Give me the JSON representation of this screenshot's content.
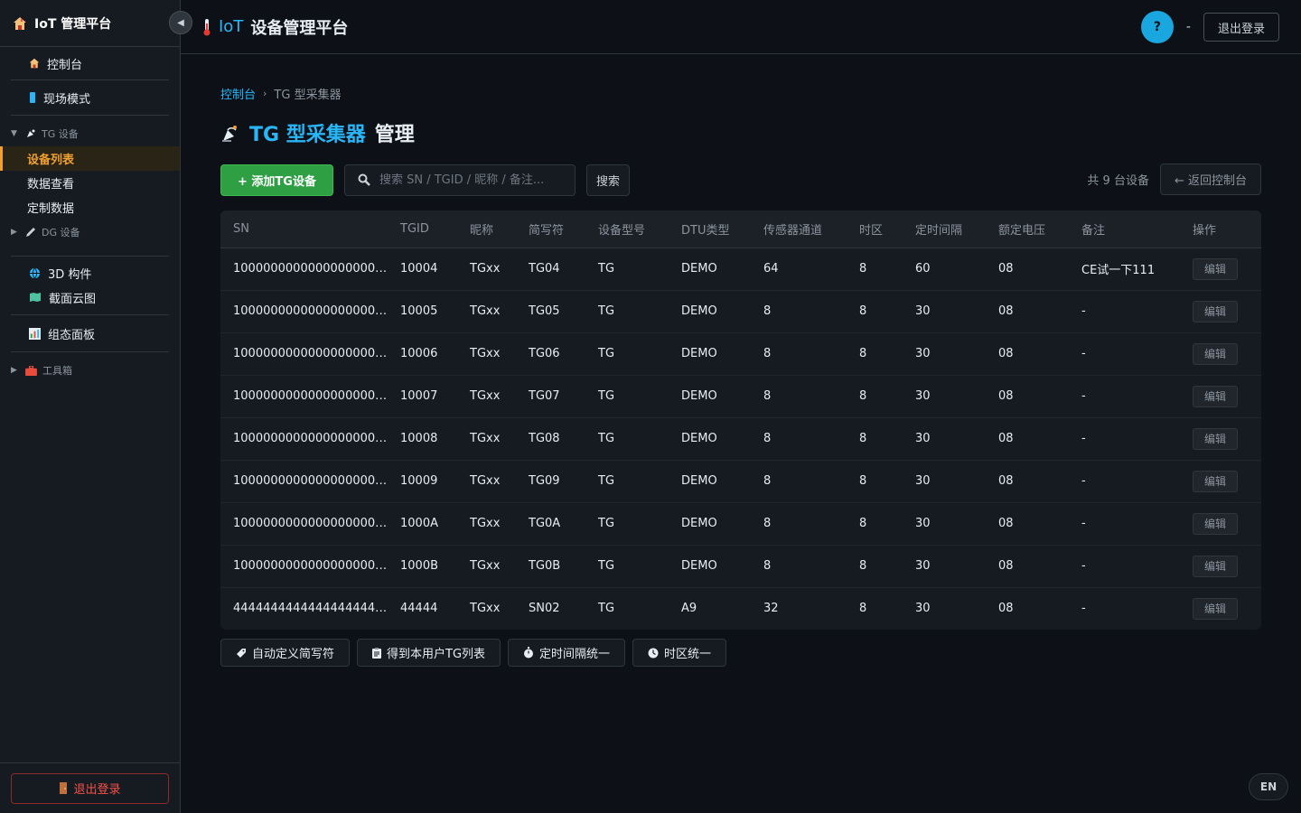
{
  "sidebar": {
    "brand": "IoT 管理平台",
    "collapse_glyph": "◀",
    "top_items": [
      {
        "label": "控制台",
        "icon": "home-icon"
      },
      {
        "label": "现场模式",
        "icon": "device-icon"
      }
    ],
    "tg_group": {
      "label": "TG 设备",
      "caret": "▼",
      "icon": "satellite-icon"
    },
    "tg_items": [
      {
        "label": "设备列表",
        "active": true
      },
      {
        "label": "数据查看"
      },
      {
        "label": "定制数据"
      }
    ],
    "dg_group": {
      "label": "DG 设备",
      "caret": "▶",
      "icon": "pen-icon"
    },
    "mid_items": [
      {
        "label": "3D 构件",
        "icon": "globe-icon"
      },
      {
        "label": "截面云图",
        "icon": "map-icon"
      }
    ],
    "panel_item": {
      "label": "组态面板",
      "icon": "chart-icon"
    },
    "tools_group": {
      "label": "工具箱",
      "caret": "▶",
      "icon": "toolbox-icon"
    },
    "logout_label": "退出登录"
  },
  "header": {
    "iot": "IoT",
    "title_rest": "设备管理平台",
    "avatar": "?",
    "user_dash": "-",
    "logout_label": "退出登录"
  },
  "breadcrumb": {
    "home": "控制台",
    "sep": "›",
    "current": "TG 型采集器"
  },
  "page_title": {
    "tg": "TG 型采集器",
    "manage": "管理"
  },
  "toolbar": {
    "add_label": "+ 添加TG设备",
    "search_placeholder": "搜索 SN / TGID / 昵称 / 备注...",
    "search_button": "搜索",
    "count_text": "共 9 台设备",
    "back_label": "← 返回控制台"
  },
  "table": {
    "headers": [
      "SN",
      "TGID",
      "昵称",
      "简写符",
      "设备型号",
      "DTU类型",
      "传感器通道",
      "时区",
      "定时间隔",
      "额定电压",
      "备注",
      "操作"
    ],
    "edit_label": "编辑",
    "rows": [
      [
        "10000000000000000000...",
        "10004",
        "TGxx",
        "TG04",
        "TG",
        "DEMO",
        "64",
        "8",
        "60",
        "08",
        "CE试一下111"
      ],
      [
        "10000000000000000000...",
        "10005",
        "TGxx",
        "TG05",
        "TG",
        "DEMO",
        "8",
        "8",
        "30",
        "08",
        "-"
      ],
      [
        "10000000000000000000...",
        "10006",
        "TGxx",
        "TG06",
        "TG",
        "DEMO",
        "8",
        "8",
        "30",
        "08",
        "-"
      ],
      [
        "10000000000000000000...",
        "10007",
        "TGxx",
        "TG07",
        "TG",
        "DEMO",
        "8",
        "8",
        "30",
        "08",
        "-"
      ],
      [
        "10000000000000000000...",
        "10008",
        "TGxx",
        "TG08",
        "TG",
        "DEMO",
        "8",
        "8",
        "30",
        "08",
        "-"
      ],
      [
        "10000000000000000000...",
        "10009",
        "TGxx",
        "TG09",
        "TG",
        "DEMO",
        "8",
        "8",
        "30",
        "08",
        "-"
      ],
      [
        "10000000000000000000...",
        "1000A",
        "TGxx",
        "TG0A",
        "TG",
        "DEMO",
        "8",
        "8",
        "30",
        "08",
        "-"
      ],
      [
        "10000000000000000000...",
        "1000B",
        "TGxx",
        "TG0B",
        "TG",
        "DEMO",
        "8",
        "8",
        "30",
        "08",
        "-"
      ],
      [
        "44444444444444444444...",
        "44444",
        "TGxx",
        "SN02",
        "TG",
        "A9",
        "32",
        "8",
        "30",
        "08",
        "-"
      ]
    ]
  },
  "actions": [
    {
      "label": "自动定义简写符",
      "icon": "tag-icon"
    },
    {
      "label": "得到本用户TG列表",
      "icon": "clipboard-icon"
    },
    {
      "label": "定时间隔统一",
      "icon": "stopwatch-icon"
    },
    {
      "label": "时区统一",
      "icon": "clock-icon"
    }
  ],
  "lang": "EN",
  "colors": {
    "accent": "#29b6f6",
    "active": "#f0a030",
    "add": "#2ea043",
    "danger": "#f85149"
  }
}
